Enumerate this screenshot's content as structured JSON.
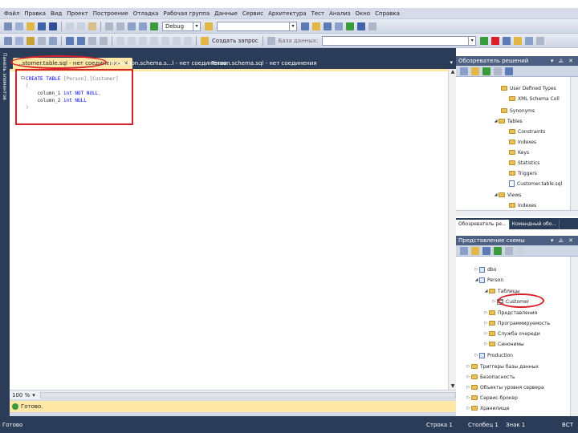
{
  "menu": [
    "Файл",
    "Правка",
    "Вид",
    "Проект",
    "Построение",
    "Отладка",
    "Рабочая группа",
    "Данные",
    "Сервис",
    "Архитектура",
    "Тест",
    "Анализ",
    "Окно",
    "Справка"
  ],
  "toolbar1": {
    "config_combo": "Debug"
  },
  "toolbar2": {
    "button_label": "Создать запрос",
    "database_label": "База данных:"
  },
  "doc_tabs": [
    {
      "label": "...stomer.table.sql - нет соединения",
      "active": true
    },
    {
      "label": "Production.schema.s...l - нет соединения",
      "active": false
    },
    {
      "label": "Person.schema.sql - нет соединения",
      "active": false
    }
  ],
  "left_strip_label": "Панель элементов",
  "editor": {
    "collapse_marker": "⊟",
    "code": {
      "l1_kw": "CREATE TABLE",
      "l1_rest": " [Person].[Customer]",
      "l2": "(",
      "l3_col": "    column_1",
      "l3_type": " int NOT NULL",
      "l3_tail": ",",
      "l4_col": "    column_2",
      "l4_type": " int NULL",
      "l5": ")"
    },
    "zoom": "100 %",
    "zoom_arrow": "▾"
  },
  "results": {
    "status": "Готово."
  },
  "status_bar": {
    "ready": "Готово",
    "line": "Строка 1",
    "column": "Столбец 1",
    "char": "Знак 1",
    "mode": "ВСТ"
  },
  "solution_explorer": {
    "title": "Обозреватель решений",
    "items": [
      {
        "label": "User Defined Types"
      },
      {
        "label": "XML Schema Coll"
      },
      {
        "label": "Synonyms"
      },
      {
        "label": "Tables"
      },
      {
        "label": "Constraints"
      },
      {
        "label": "Indexes"
      },
      {
        "label": "Keys"
      },
      {
        "label": "Statistics"
      },
      {
        "label": "Triggers"
      },
      {
        "label": "Customer.table.sql"
      },
      {
        "label": "Views"
      },
      {
        "label": "Indexes"
      }
    ],
    "tabs": [
      "Обозреватель ре...",
      "Командный обо..."
    ]
  },
  "schema_view": {
    "title": "Представление схемы",
    "items": [
      {
        "label": "dbo"
      },
      {
        "label": "Person"
      },
      {
        "label": "Таблицы"
      },
      {
        "label": "Customer"
      },
      {
        "label": "Представления"
      },
      {
        "label": "Программируемость"
      },
      {
        "label": "Служба очереди"
      },
      {
        "label": "Синонимы"
      },
      {
        "label": "Production"
      },
      {
        "label": "Триггеры базы данных"
      },
      {
        "label": "Безопасность"
      },
      {
        "label": "Объекты уровня сервера"
      },
      {
        "label": "Сервис-брокер"
      },
      {
        "label": "Хранилище"
      }
    ]
  },
  "panel_controls": "▾ ⨹ ✕",
  "colors": {
    "accent": "#2b3c59",
    "active_tab": "#ffe8a6",
    "highlight": "#d8202a",
    "keyword": "#0000ff"
  }
}
